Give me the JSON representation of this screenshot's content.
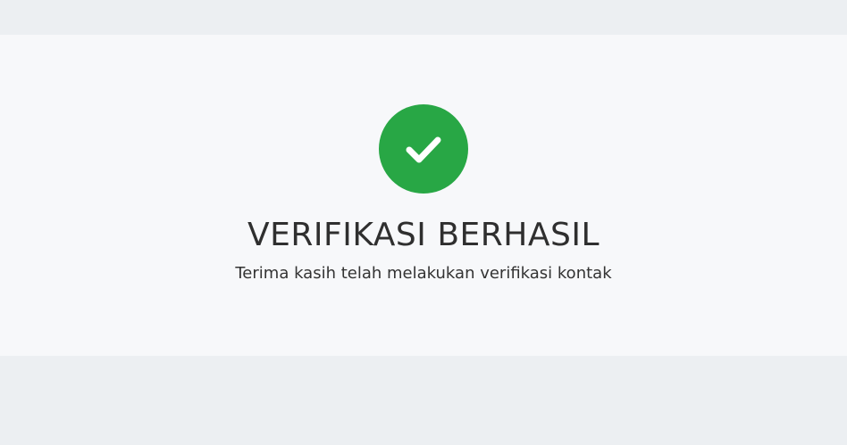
{
  "status": {
    "icon": "check-circle-icon",
    "title": "VERIFIKASI BERHASIL",
    "message": "Terima kasih telah melakukan verifikasi kontak"
  },
  "colors": {
    "success": "#28a745",
    "page_background": "#eceff2",
    "card_background": "#f7f8fa",
    "text": "#2f2f2f"
  }
}
